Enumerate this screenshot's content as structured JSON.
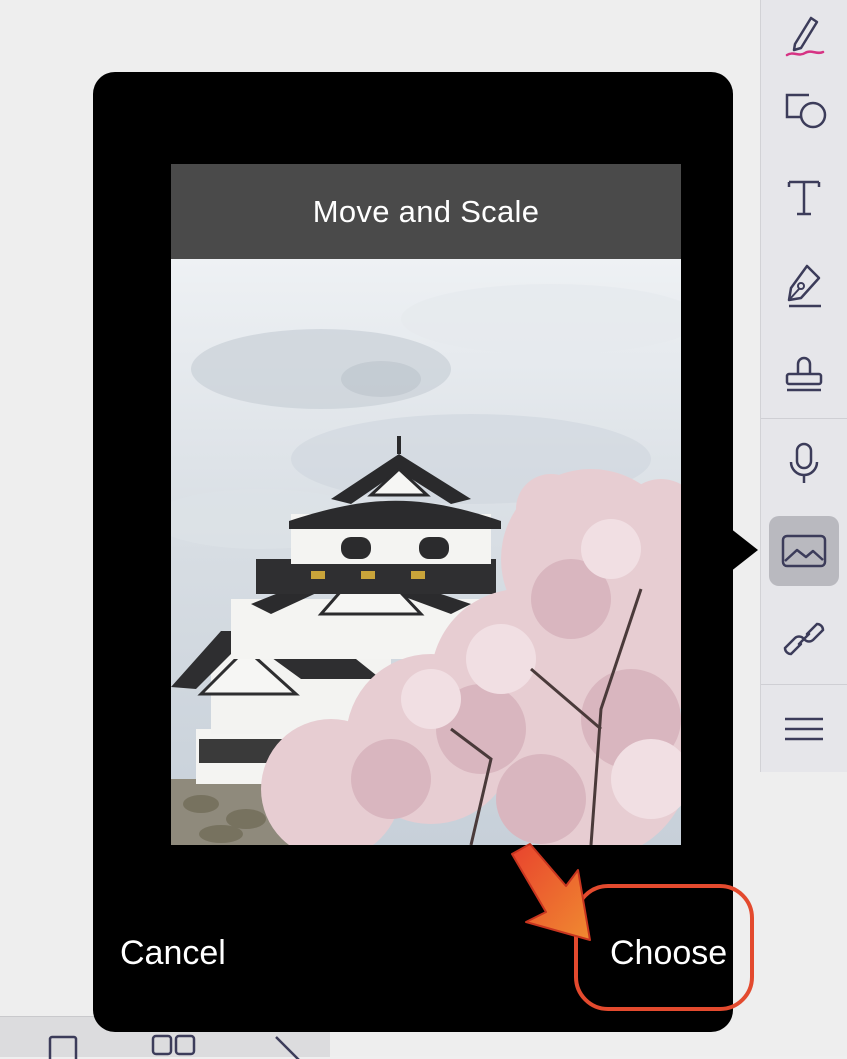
{
  "dialog": {
    "title": "Move and Scale",
    "cancel_label": "Cancel",
    "choose_label": "Choose"
  },
  "toolbar": {
    "tools": [
      {
        "name": "pen-tool",
        "icon": "pen-icon"
      },
      {
        "name": "shapes-tool",
        "icon": "shapes-icon"
      },
      {
        "name": "text-tool",
        "icon": "text-icon"
      },
      {
        "name": "signature-tool",
        "icon": "fountain-pen-icon"
      },
      {
        "name": "stamp-tool",
        "icon": "stamp-icon"
      },
      {
        "name": "audio-tool",
        "icon": "microphone-icon"
      },
      {
        "name": "image-tool",
        "icon": "image-icon",
        "active": true
      },
      {
        "name": "link-tool",
        "icon": "link-icon"
      },
      {
        "name": "more-tool",
        "icon": "menu-icon"
      }
    ]
  },
  "colors": {
    "popover_background": "#000000",
    "title_bar": "#4a4a4a",
    "highlight": "#e34a2e",
    "toolbar_icon": "#3c3c5a",
    "pen_accent": "#d63384"
  }
}
